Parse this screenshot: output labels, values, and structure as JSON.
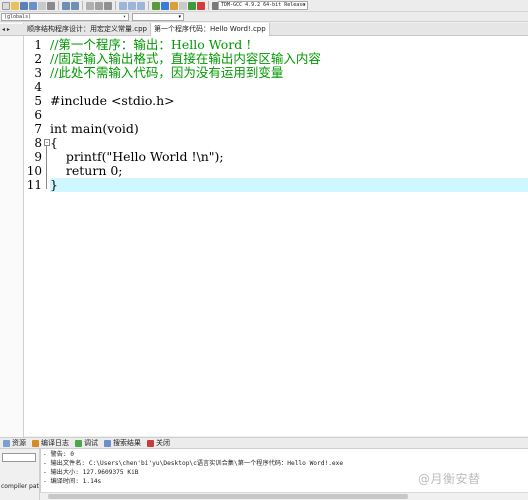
{
  "toolbar": {
    "compiler": "TDM-GCC 4.9.2 64-bit Release",
    "buttons": [
      "new-file-icon",
      "open-icon",
      "save-icon",
      "save-all-icon",
      "close-icon",
      "print-icon",
      "undo-icon",
      "redo-icon",
      "find-icon",
      "replace-icon",
      "goto-icon",
      "compile-icon",
      "run-icon",
      "compile-run-icon",
      "rebuild-icon",
      "check-icon",
      "stop-icon",
      "debug-icon",
      "profile-icon",
      "chart-icon"
    ]
  },
  "toolbar2": {
    "scope_select": "(globals)",
    "scope_arrow": "▾",
    "second_arrow": "▾"
  },
  "left_panel": {
    "scroll_label": "◂ ▸"
  },
  "tabs": [
    {
      "label": "顺序结构程序设计：用宏定义常量.cpp",
      "active": false
    },
    {
      "label": "第一个程序代码：Hello Word!.cpp",
      "active": true
    }
  ],
  "editor": {
    "line_numbers": [
      "1",
      "2",
      "3",
      "4",
      "5",
      "6",
      "7",
      "8",
      "9",
      "10",
      "11"
    ],
    "fold_marker": "-",
    "lines": [
      {
        "text": "//第一个程序：输出：Hello Word !",
        "type": "comment"
      },
      {
        "text": "//固定输入输出格式，直接在输出内容区输入内容",
        "type": "comment"
      },
      {
        "text": "//此处不需输入代码，因为没有运用到变量",
        "type": "comment"
      },
      {
        "text": "",
        "type": "code"
      },
      {
        "text": "#include <stdio.h>",
        "type": "code"
      },
      {
        "text": "",
        "type": "code"
      },
      {
        "text": "int main(void)",
        "type": "code"
      },
      {
        "text": "{",
        "type": "code"
      },
      {
        "text": "    printf(\"Hello World !\\n\");",
        "type": "code"
      },
      {
        "text": "    return 0;",
        "type": "code"
      },
      {
        "text": "}",
        "type": "code",
        "highlight": true
      }
    ]
  },
  "bottom_tabs": [
    {
      "label": "资源",
      "icon_color": "#7a9fd4"
    },
    {
      "label": "编译日志",
      "icon_color": "#d98b2a"
    },
    {
      "label": "调试",
      "icon_color": "#4aa84a"
    },
    {
      "label": "搜索结果",
      "icon_color": "#6c8ec9"
    },
    {
      "label": "关闭",
      "icon_color": "#cc3b3b"
    }
  ],
  "bottom_left_label": "compiler pat",
  "log": [
    "- 警告: 0",
    "- 输出文件名: C:\\Users\\chen'bi'yu\\Desktop\\c语言实训合集\\第一个程序代码：Hello Word!.exe",
    "- 输出大小: 127.9609375 KiB",
    "- 编译时间: 1.14s"
  ],
  "watermark": "@月衡安替"
}
